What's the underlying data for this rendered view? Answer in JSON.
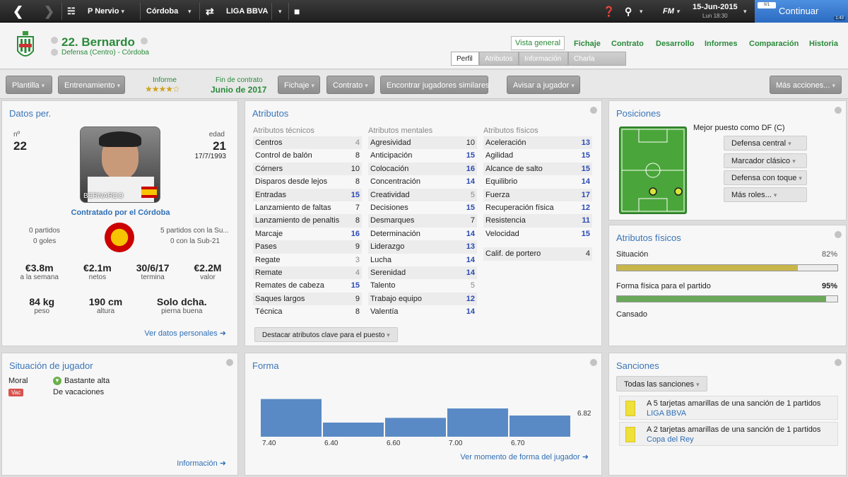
{
  "topbar": {
    "club": "P Nervio",
    "team": "Córdoba",
    "competition": "LIGA BBVA",
    "fm": "FM",
    "date": "15-Jun-2015",
    "time": "Lun 18:30",
    "continue": "Continuar",
    "badge_top": "0/1",
    "badge_time": "1:43"
  },
  "header": {
    "name": "22. Bernardo",
    "position": "Defensa (Centro) - Córdoba",
    "nav": [
      "Vista general",
      "Fichaje",
      "Contrato",
      "Desarrollo",
      "Informes",
      "Comparación",
      "Historia"
    ],
    "subtabs": [
      "Perfil",
      "Atributos",
      "Información",
      "Charla Privada"
    ]
  },
  "toolbar": {
    "plantilla": "Plantilla",
    "entrenamiento": "Entrenamiento",
    "informe": "Informe",
    "rating_stars": 4.5,
    "fin_contrato": "Fin de contrato",
    "fin_date": "Junio de 2017",
    "fichaje": "Fichaje",
    "contrato": "Contrato",
    "similares": "Encontrar jugadores similares",
    "avisar": "Avisar a jugador",
    "mas": "Más acciones..."
  },
  "datos": {
    "title": "Datos per.",
    "num_label": "nº",
    "num": "22",
    "edad_label": "edad",
    "edad": "21",
    "birth": "17/7/1993",
    "photo_name": "BERNARDO",
    "contratado": "Contratado por el Córdoba",
    "partidos": "0 partidos",
    "goles": "0 goles",
    "sub21_p": "5 partidos con la Su...",
    "sub21_g": "0 con la Sub-21",
    "stats": [
      {
        "v": "€3.8m",
        "l": "a la semana"
      },
      {
        "v": "€2.1m",
        "l": "netos"
      },
      {
        "v": "30/6/17",
        "l": "termina"
      },
      {
        "v": "€2.2M",
        "l": "valor"
      }
    ],
    "phys": [
      {
        "v": "84 kg",
        "l": "peso"
      },
      {
        "v": "190 cm",
        "l": "altura"
      },
      {
        "v": "Solo dcha.",
        "l": "pierna buena"
      }
    ],
    "link": "Ver datos personales"
  },
  "atributos": {
    "title": "Atributos",
    "tecnicos_h": "Atributos técnicos",
    "mentales_h": "Atributos mentales",
    "fisicos_h": "Atributos físicos",
    "tecnicos": [
      {
        "n": "Centros",
        "v": 4
      },
      {
        "n": "Control de balón",
        "v": 8
      },
      {
        "n": "Córners",
        "v": 10
      },
      {
        "n": "Disparos desde lejos",
        "v": 8
      },
      {
        "n": "Entradas",
        "v": 15
      },
      {
        "n": "Lanzamiento de faltas",
        "v": 7
      },
      {
        "n": "Lanzamiento de penaltis",
        "v": 8
      },
      {
        "n": "Marcaje",
        "v": 16
      },
      {
        "n": "Pases",
        "v": 9
      },
      {
        "n": "Regate",
        "v": 3
      },
      {
        "n": "Remate",
        "v": 4
      },
      {
        "n": "Remates de cabeza",
        "v": 15
      },
      {
        "n": "Saques largos",
        "v": 9
      },
      {
        "n": "Técnica",
        "v": 8
      }
    ],
    "mentales": [
      {
        "n": "Agresividad",
        "v": 10
      },
      {
        "n": "Anticipación",
        "v": 15
      },
      {
        "n": "Colocación",
        "v": 16
      },
      {
        "n": "Concentración",
        "v": 14
      },
      {
        "n": "Creatividad",
        "v": 5
      },
      {
        "n": "Decisiones",
        "v": 15
      },
      {
        "n": "Desmarques",
        "v": 7
      },
      {
        "n": "Determinación",
        "v": 14
      },
      {
        "n": "Liderazgo",
        "v": 13
      },
      {
        "n": "Lucha",
        "v": 14
      },
      {
        "n": "Serenidad",
        "v": 14
      },
      {
        "n": "Talento",
        "v": 5
      },
      {
        "n": "Trabajo equipo",
        "v": 12
      },
      {
        "n": "Valentía",
        "v": 14
      }
    ],
    "fisicos": [
      {
        "n": "Aceleración",
        "v": 13
      },
      {
        "n": "Agilidad",
        "v": 15
      },
      {
        "n": "Alcance de salto",
        "v": 15
      },
      {
        "n": "Equilibrio",
        "v": 14
      },
      {
        "n": "Fuerza",
        "v": 17
      },
      {
        "n": "Recuperación física",
        "v": 12
      },
      {
        "n": "Resistencia",
        "v": 11
      },
      {
        "n": "Velocidad",
        "v": 15
      }
    ],
    "portero": {
      "n": "Calif. de portero",
      "v": 4
    },
    "destacar": "Destacar atributos clave para el puesto"
  },
  "posiciones": {
    "title": "Posiciones",
    "mejor": "Mejor puesto como DF (C)",
    "roles": [
      "Defensa central",
      "Marcador clásico",
      "Defensa con toque",
      "Más roles..."
    ]
  },
  "fisicos": {
    "title": "Atributos físicos",
    "situacion": "Situación",
    "situacion_pct": "82%",
    "situacion_val": 0.82,
    "forma": "Forma física para el partido",
    "forma_pct": "95%",
    "forma_val": 0.95,
    "cansado": "Cansado",
    "colors": {
      "situacion": "#c8b64a",
      "forma": "#6aa85a"
    }
  },
  "situacion": {
    "title": "Situación de jugador",
    "moral_label": "Moral",
    "moral": "Bastante alta",
    "vac_badge": "Vac",
    "vac": "De vacaciones",
    "link": "Información"
  },
  "forma": {
    "title": "Forma",
    "link": "Ver momento de forma del jugador"
  },
  "chart_data": {
    "type": "bar",
    "categories": [
      "",
      "",
      "",
      "",
      ""
    ],
    "values": [
      7.4,
      6.4,
      6.6,
      7.0,
      6.7
    ],
    "labels": [
      "7.40",
      "6.40",
      "6.60",
      "7.00",
      "6.70"
    ],
    "average": 6.82,
    "average_label": "6.82",
    "color": "#5a8ac6"
  },
  "sanciones": {
    "title": "Sanciones",
    "filter": "Todas las sanciones",
    "items": [
      {
        "text": "A 5 tarjetas amarillas de una sanción de 1 partidos",
        "comp": "LIGA BBVA"
      },
      {
        "text": "A 2 tarjetas amarillas de una sanción de 1 partidos",
        "comp": "Copa del Rey"
      }
    ]
  }
}
